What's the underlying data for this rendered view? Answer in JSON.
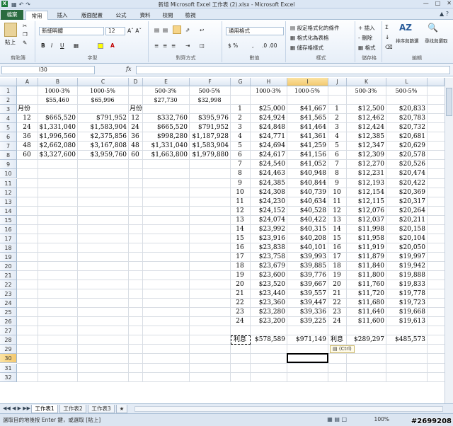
{
  "window": {
    "title": "新增 Microsoft Excel 工作表 (2).xlsx - Microsoft Excel",
    "app_icon": "X"
  },
  "tabs": [
    "檔案",
    "常用",
    "插入",
    "版面配置",
    "公式",
    "資料",
    "校閱",
    "檢視"
  ],
  "ribbon": {
    "font_name": "新細明體",
    "font_size": "12",
    "number_format": "通用格式",
    "paste_label": "貼上",
    "groups": [
      "剪貼簿",
      "字型",
      "對齊方式",
      "數值",
      "樣式",
      "儲存格",
      "編輯"
    ],
    "styles": [
      "設定格式化的條件",
      "格式化為表格",
      "儲存格樣式"
    ],
    "cells": [
      "插入",
      "刪除",
      "格式"
    ],
    "editing": [
      "排序與篩選",
      "尋找與選取"
    ],
    "font_buttons": [
      "B",
      "I",
      "U"
    ]
  },
  "formula_bar": {
    "name_box": "I30",
    "fx": "fx",
    "value": ""
  },
  "columns": [
    "A",
    "B",
    "C",
    "D",
    "E",
    "F",
    "G",
    "H",
    "I",
    "J",
    "K",
    "L"
  ],
  "rows": [
    "1",
    "2",
    "3",
    "4",
    "5",
    "6",
    "7",
    "8",
    "9",
    "10",
    "11",
    "12",
    "13",
    "14",
    "15",
    "16",
    "17",
    "18",
    "19",
    "20",
    "21",
    "22",
    "23",
    "24",
    "25",
    "26",
    "27",
    "28",
    "29",
    "30",
    "31",
    "32"
  ],
  "left_table": {
    "row1": {
      "B": "1000-3%",
      "C": "1000-5%",
      "E": "500-3%",
      "F": "500-5%"
    },
    "row2": {
      "B": "$55,460",
      "C": "$65,996",
      "E": "$27,730",
      "F": "$32,998"
    },
    "row3": {
      "A": "月份",
      "D": "月份"
    },
    "data": [
      {
        "A": "12",
        "B": "$665,520",
        "C": "$791,952",
        "D": "12",
        "E": "$332,760",
        "F": "$395,976"
      },
      {
        "A": "24",
        "B": "$1,331,040",
        "C": "$1,583,904",
        "D": "24",
        "E": "$665,520",
        "F": "$791,952"
      },
      {
        "A": "36",
        "B": "$1,996,560",
        "C": "$2,375,856",
        "D": "36",
        "E": "$998,280",
        "F": "$1,187,928"
      },
      {
        "A": "48",
        "B": "$2,662,080",
        "C": "$3,167,808",
        "D": "48",
        "E": "$1,331,040",
        "F": "$1,583,904"
      },
      {
        "A": "60",
        "B": "$3,327,600",
        "C": "$3,959,760",
        "D": "60",
        "E": "$1,663,800",
        "F": "$1,979,880"
      }
    ]
  },
  "right_table": {
    "row1": {
      "H": "1000-3%",
      "I": "1000-5%",
      "K": "500-3%",
      "L": "500-5%"
    },
    "data": [
      [
        "1",
        "$25,000",
        "$41,667",
        "1",
        "$12,500",
        "$20,833"
      ],
      [
        "2",
        "$24,924",
        "$41,565",
        "2",
        "$12,462",
        "$20,783"
      ],
      [
        "3",
        "$24,848",
        "$41,464",
        "3",
        "$12,424",
        "$20,732"
      ],
      [
        "4",
        "$24,771",
        "$41,361",
        "4",
        "$12,385",
        "$20,681"
      ],
      [
        "5",
        "$24,694",
        "$41,259",
        "5",
        "$12,347",
        "$20,629"
      ],
      [
        "6",
        "$24,617",
        "$41,156",
        "6",
        "$12,309",
        "$20,578"
      ],
      [
        "7",
        "$24,540",
        "$41,052",
        "7",
        "$12,270",
        "$20,526"
      ],
      [
        "8",
        "$24,463",
        "$40,948",
        "8",
        "$12,231",
        "$20,474"
      ],
      [
        "9",
        "$24,385",
        "$40,844",
        "9",
        "$12,193",
        "$20,422"
      ],
      [
        "10",
        "$24,308",
        "$40,739",
        "10",
        "$12,154",
        "$20,369"
      ],
      [
        "11",
        "$24,230",
        "$40,634",
        "11",
        "$12,115",
        "$20,317"
      ],
      [
        "12",
        "$24,152",
        "$40,528",
        "12",
        "$12,076",
        "$20,264"
      ],
      [
        "13",
        "$24,074",
        "$40,422",
        "13",
        "$12,037",
        "$20,211"
      ],
      [
        "14",
        "$23,992",
        "$40,315",
        "14",
        "$11,998",
        "$20,158"
      ],
      [
        "15",
        "$23,916",
        "$40,208",
        "15",
        "$11,958",
        "$20,104"
      ],
      [
        "16",
        "$23,838",
        "$40,101",
        "16",
        "$11,919",
        "$20,050"
      ],
      [
        "17",
        "$23,758",
        "$39,993",
        "17",
        "$11,879",
        "$19,997"
      ],
      [
        "18",
        "$23,679",
        "$39,885",
        "18",
        "$11,840",
        "$19,942"
      ],
      [
        "19",
        "$23,600",
        "$39,776",
        "19",
        "$11,800",
        "$19,888"
      ],
      [
        "20",
        "$23,520",
        "$39,667",
        "20",
        "$11,760",
        "$19,833"
      ],
      [
        "21",
        "$23,440",
        "$39,557",
        "21",
        "$11,720",
        "$19,778"
      ],
      [
        "22",
        "$23,360",
        "$39,447",
        "22",
        "$11,680",
        "$19,723"
      ],
      [
        "23",
        "$23,280",
        "$39,336",
        "23",
        "$11,640",
        "$19,668"
      ],
      [
        "24",
        "$23,200",
        "$39,225",
        "24",
        "$11,600",
        "$19,613"
      ]
    ],
    "total_row": {
      "G": "利息",
      "H": "$578,589",
      "I": "$971,149",
      "J": "利息",
      "K": "$289,297",
      "L": "$485,573"
    }
  },
  "paste_options": "(Ctrl)",
  "sheet_tabs": [
    "工作表1",
    "工作表2",
    "工作表3"
  ],
  "status": {
    "message": "選取目的地後按 Enter 鍵，或選取 [貼上]",
    "zoom": "100%"
  },
  "watermark": "#2699208"
}
